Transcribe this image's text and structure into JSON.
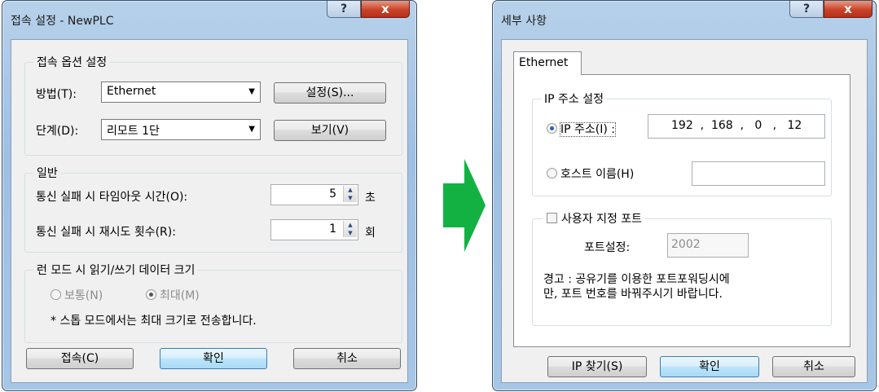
{
  "left_dialog": {
    "title": "접속 설정 - NewPLC",
    "help_glyph": "?",
    "close_glyph": "x",
    "connection_group": {
      "label": "접속 옵션 설정",
      "method_label": "방법(T):",
      "method_value": "Ethernet",
      "settings_button": "설정(S)...",
      "stage_label": "단계(D):",
      "stage_value": "리모트 1단",
      "view_button": "보기(V)"
    },
    "general_group": {
      "label": "일반",
      "timeout_label": "통신 실패 시 타임아웃 시간(O):",
      "timeout_value": "5",
      "timeout_unit": "초",
      "retry_label": "통신 실패 시 재시도 횟수(R):",
      "retry_value": "1",
      "retry_unit": "회"
    },
    "run_mode_group": {
      "label": "런 모드 시 읽기/쓰기 데이터 크기",
      "normal_option": "보통(N)",
      "max_option": "최대(M)",
      "note": "* 스톱 모드에서는 최대 크기로 전송합니다."
    },
    "connect_button": "접속(C)",
    "ok_button": "확인",
    "cancel_button": "취소"
  },
  "right_dialog": {
    "title": "세부 사항",
    "help_glyph": "?",
    "close_glyph": "x",
    "tab_label": "Ethernet",
    "ip_group": {
      "label": "IP 주소 설정",
      "ip_option": "IP 주소(I) :",
      "ip_value": "192  ,  168  ,   0   ,   12",
      "host_option": "호스트 이름(H)",
      "host_value": ""
    },
    "port_group": {
      "checkbox_label": "사용자 지정 포트",
      "port_label": "포트설정:",
      "port_value": "2002",
      "warning_line1": "경고 : 공유기를 이용한 포트포워딩시에",
      "warning_line2": "만, 포트 번호를 바꿔주시기 바랍니다."
    },
    "find_ip_button": "IP 찾기(S)",
    "ok_button": "확인",
    "cancel_button": "취소"
  },
  "colors": {
    "arrow": "#12b142",
    "title_bar": "#a6c6e6",
    "close_button": "#c9432a"
  }
}
